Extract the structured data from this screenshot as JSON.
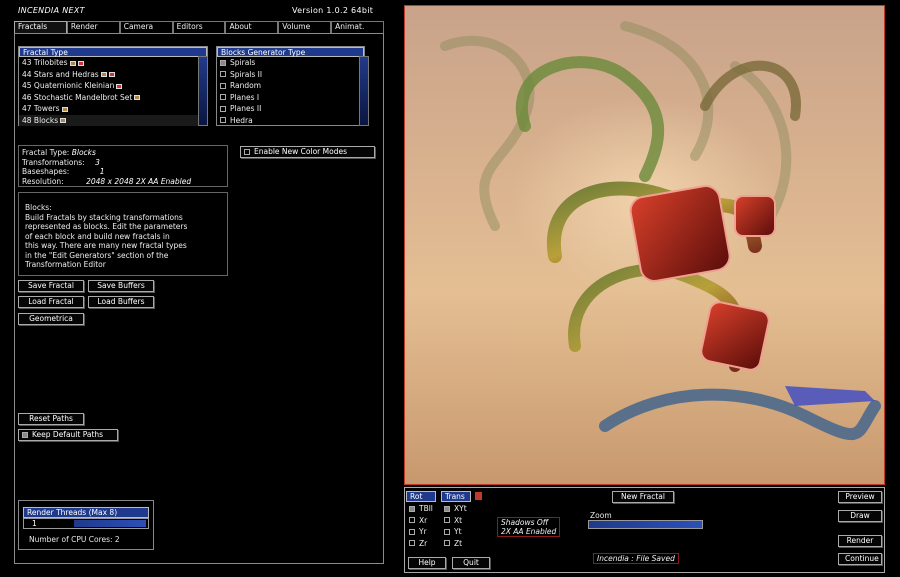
{
  "app": {
    "title": "INCENDIA NEXT",
    "version": "Version 1.0.2 64bit"
  },
  "menu": [
    "Fractals",
    "Render",
    "Camera",
    "Editors",
    "About",
    "Volume",
    "Animat."
  ],
  "fractal_list": {
    "header": "Fractal Type",
    "items": [
      "43 Trilobites",
      "44 Stars and Hedras",
      "45 Quaternionic Kleinian",
      "46 Stochastic Mandelbrot Set",
      "47 Towers",
      "48 Blocks"
    ]
  },
  "generator_list": {
    "header": "Blocks Generator Type",
    "items": [
      "Spirals",
      "Spirals II",
      "Random",
      "Planes I",
      "Planes II",
      "Hedra"
    ]
  },
  "color_modes": {
    "label": "Enable New Color Modes"
  },
  "info": {
    "fractal_type_label": "Fractal Type:",
    "fractal_type_value": "Blocks",
    "transformations_label": "Transformations:",
    "transformations_value": "3",
    "baseshapes_label": "Baseshapes:",
    "baseshapes_value": "1",
    "resolution_label": "Resolution:",
    "resolution_value": "2048 x 2048  2X AA Enabled"
  },
  "description": {
    "title": "Blocks:",
    "lines": [
      "Build Fractals by stacking transformations",
      "represented as blocks. Edit the parameters",
      "of each block  and build  new  fractals in",
      "this way. There are many new fractal types",
      "in the \"Edit Generators\" section  of the",
      "Transformation Editor"
    ]
  },
  "buttons": {
    "save_fractal": "Save Fractal",
    "save_buffers": "Save Buffers",
    "load_fractal": "Load Fractal",
    "load_buffers": "Load Buffers",
    "geometrica": "Geometrica",
    "reset_paths": "Reset Paths",
    "keep_default_paths": "Keep Default Paths"
  },
  "threads": {
    "header": "Render Threads (Max 8)",
    "value": "1",
    "cores": "Number of CPU Cores: 2"
  },
  "bottom": {
    "rot": "Rot",
    "trans": "Trans",
    "rot_items": [
      "TBll",
      "Xr",
      "Yr",
      "Zr"
    ],
    "trans_items": [
      "XYt",
      "Xt",
      "Yt",
      "Zt"
    ],
    "help": "Help",
    "quit": "Quit",
    "new_fractal": "New Fractal",
    "shadows": "Shadows Off",
    "aa": "2X AA Enabled",
    "zoom": "Zoom",
    "status": "Incendia :  File Saved",
    "preview": "Preview",
    "draw": "Draw",
    "render": "Render",
    "continue": "Continue"
  }
}
